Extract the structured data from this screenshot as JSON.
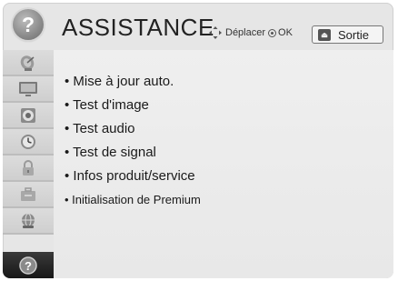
{
  "header": {
    "title": "ASSISTANCE",
    "nav_hint_move": "Déplacer",
    "nav_hint_ok": "OK",
    "exit_key": "⏏",
    "exit_label": "Sortie",
    "help_glyph": "?"
  },
  "sidebar": {
    "items": [
      {
        "icon": "satellite-dish-icon"
      },
      {
        "icon": "tv-screen-icon"
      },
      {
        "icon": "speaker-icon"
      },
      {
        "icon": "clock-icon"
      },
      {
        "icon": "lock-icon"
      },
      {
        "icon": "toolbox-icon"
      },
      {
        "icon": "network-globe-icon"
      },
      {
        "icon": "help-icon",
        "active": true
      }
    ]
  },
  "menu": {
    "items": [
      {
        "label": "• Mise à jour auto."
      },
      {
        "label": "• Test d'image"
      },
      {
        "label": "• Test audio"
      },
      {
        "label": "• Test de signal"
      },
      {
        "label": "• Infos produit/service"
      },
      {
        "label": "• Initialisation de Premium"
      }
    ]
  },
  "colors": {
    "background": "#e6e6e6",
    "sidebar_active": "#1e1e1e",
    "text": "#1a1a1a"
  }
}
